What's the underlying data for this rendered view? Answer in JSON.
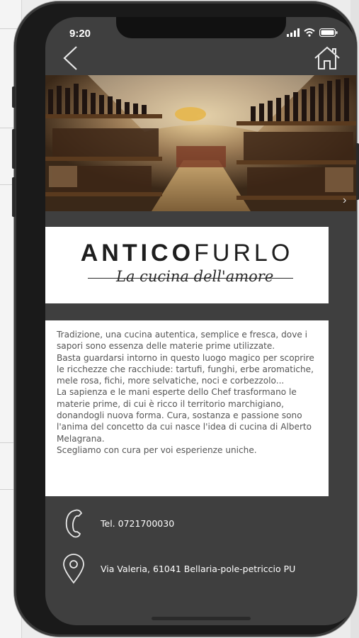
{
  "status_bar": {
    "time": "9:20"
  },
  "nav": {
    "back_icon": "chevron-left-icon",
    "home_icon": "home-icon"
  },
  "carousel": {
    "slide_count": 3,
    "active_slide": 1,
    "next_icon": "chevron-right-icon"
  },
  "logo": {
    "word_bold": "ANTICO",
    "word_light": "FURLO",
    "tagline": "La cucina dell'amore"
  },
  "description": [
    "Tradizione, una cucina autentica, semplice e fresca, dove i sapori sono essenza delle materie prime utilizzate.",
    "Basta guardarsi intorno in questo luogo magico per scoprire le ricchezze che racchiude: tartufi, funghi, erbe aromatiche, mele rosa, fichi, more selvatiche, noci e corbezzolo...",
    "La sapienza e le mani esperte dello Chef trasformano le materie prime, di cui è ricco il territorio marchigiano, donandogli nuova forma. Cura, sostanza e passione sono l'anima del concetto da cui nasce l'idea di cucina di Alberto Melagrana.",
    "Scegliamo con cura per voi esperienze uniche."
  ],
  "contact": {
    "phone": "Tel. 0721700030",
    "address": "Via Valeria, 61041 Bellaria-pole-petriccio PU"
  },
  "colors": {
    "screen_bg": "#3f3f3f",
    "card_bg": "#ffffff",
    "text": "#555555"
  }
}
